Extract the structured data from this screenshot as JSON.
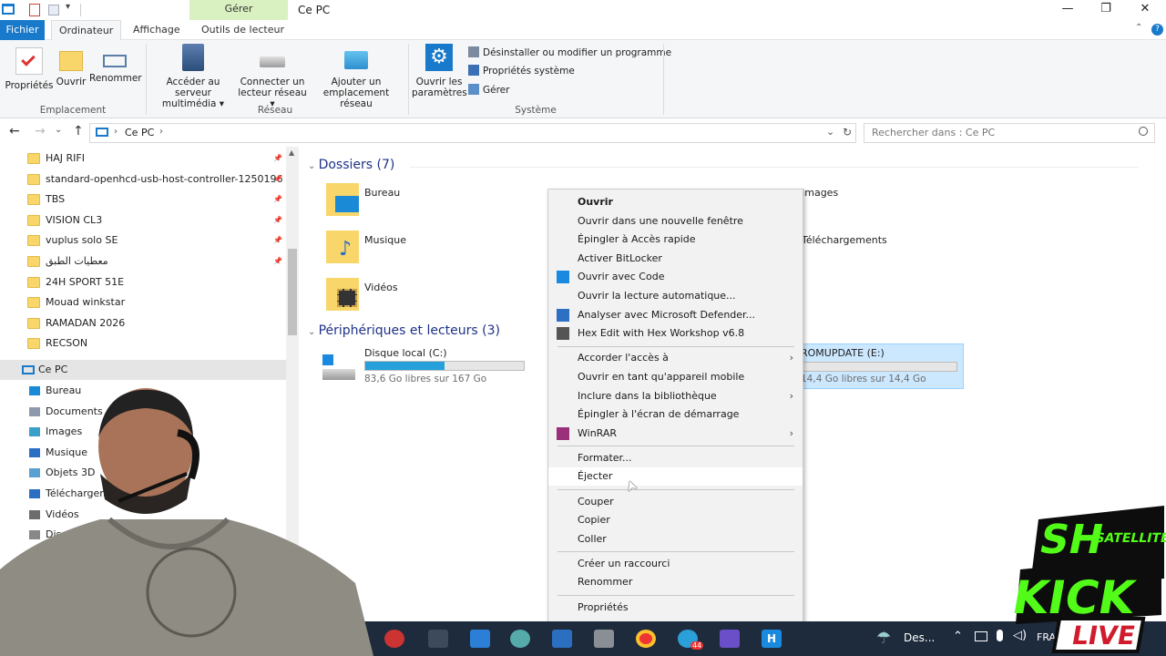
{
  "window": {
    "title": "Ce PC",
    "manage_tab": "Gérer",
    "minimize": "—",
    "restore": "❐",
    "close": "✕"
  },
  "tabs": [
    "Fichier",
    "Ordinateur",
    "Affichage",
    "Outils de lecteur"
  ],
  "ribbon": {
    "proprietes": "Propriétés",
    "ouvrir": "Ouvrir",
    "renommer": "Renommer",
    "group_emplacement": "Emplacement",
    "acceder_l1": "Accéder au serveur",
    "acceder_l2": "multimédia ▾",
    "connecter_l1": "Connecter un",
    "connecter_l2": "lecteur réseau ▾",
    "ajouter_l1": "Ajouter un",
    "ajouter_l2": "emplacement réseau",
    "group_reseau": "Réseau",
    "parametres_l1": "Ouvrir les",
    "parametres_l2": "paramètres",
    "desinstaller": "Désinstaller ou modifier un programme",
    "proprietes_systeme": "Propriétés système",
    "gerer": "Gérer",
    "group_systeme": "Système"
  },
  "address": {
    "path": "Ce PC",
    "search_placeholder": "Rechercher dans : Ce PC"
  },
  "nav": {
    "quick": [
      {
        "label": "HAJ RIFI",
        "pinned": true
      },
      {
        "label": "standard-openhcd-usb-host-controller-1250196",
        "pinned": true
      },
      {
        "label": "TBS",
        "pinned": true
      },
      {
        "label": "VISION CL3",
        "pinned": true
      },
      {
        "label": "vuplus solo SE",
        "pinned": true
      },
      {
        "label": "معطيات الطبق",
        "pinned": true
      },
      {
        "label": "24H SPORT 51E",
        "pinned": false
      },
      {
        "label": "Mouad winkstar",
        "pinned": false
      },
      {
        "label": "RAMADAN 2026",
        "pinned": false
      },
      {
        "label": "RECSON",
        "pinned": false
      }
    ],
    "this_pc": "Ce PC",
    "pc_items": [
      "Bureau",
      "Documents",
      "Images",
      "Musique",
      "Objets 3D",
      "Téléchargem",
      "Vidéos",
      "Disq"
    ]
  },
  "content": {
    "folders_header": "Dossiers (7)",
    "folders": [
      "Bureau",
      "Musique",
      "Vidéos",
      "Images",
      "Téléchargements"
    ],
    "devices_header": "Périphériques et lecteurs (3)",
    "drive_c": {
      "name": "Disque local (C:)",
      "info": "83,6 Go libres sur 167 Go",
      "used_fraction": 0.5
    },
    "drive_e": {
      "name": "ROMUPDATE (E:)",
      "info": "14,4 Go libres sur 14,4 Go",
      "used_fraction": 0.0
    }
  },
  "context_menu": {
    "items": [
      {
        "label": "Ouvrir",
        "bold": true
      },
      {
        "label": "Ouvrir dans une nouvelle fenêtre"
      },
      {
        "label": "Épingler à Accès rapide"
      },
      {
        "label": "Activer BitLocker"
      },
      {
        "label": "Ouvrir avec Code",
        "icon": "vscode-icon"
      },
      {
        "label": "Ouvrir la lecture automatique..."
      },
      {
        "label": "Analyser avec Microsoft Defender...",
        "icon": "defender-icon"
      },
      {
        "label": "Hex Edit with Hex Workshop v6.8",
        "icon": "hex-icon"
      },
      {
        "label": "Accorder l'accès à",
        "submenu": true
      },
      {
        "label": "Ouvrir en tant qu'appareil mobile"
      },
      {
        "label": "Inclure dans la bibliothèque",
        "submenu": true
      },
      {
        "label": "Épingler à l'écran de démarrage"
      },
      {
        "label": "WinRAR",
        "submenu": true,
        "icon": "winrar-icon"
      },
      {
        "label": "Formater..."
      },
      {
        "label": "Éjecter",
        "hover": true
      },
      {
        "label": "Couper"
      },
      {
        "label": "Copier"
      },
      {
        "label": "Coller"
      },
      {
        "label": "Créer un raccourci"
      },
      {
        "label": "Renommer"
      },
      {
        "label": "Propriétés"
      }
    ]
  },
  "taskbar": {
    "weather": "Des...",
    "language": "FRA",
    "badge": "44"
  },
  "overlay": {
    "logo_lines": [
      "SH",
      "SATELLITE",
      "KICK",
      "LIVE"
    ]
  },
  "colors": {
    "accent": "#1979ca",
    "manage_band": "#d9f0c1",
    "drive_fill": "#26a0da",
    "menu_bg": "#f2f2f2"
  }
}
